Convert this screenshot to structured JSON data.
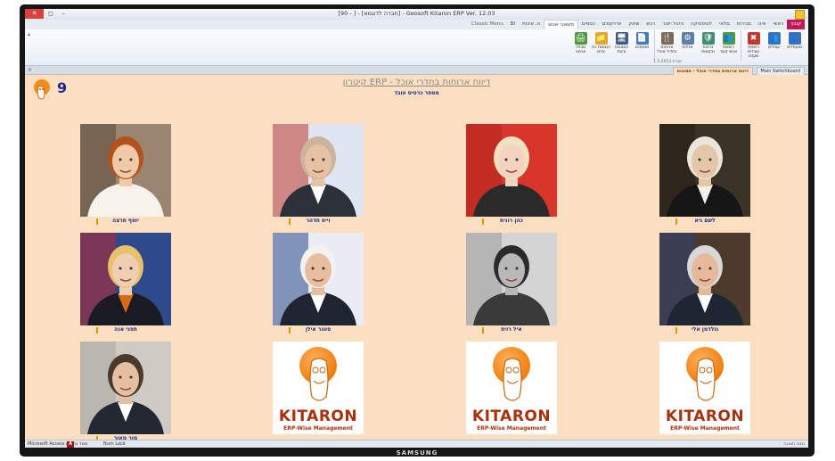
{
  "device": {
    "brand": "SAMSUNG"
  },
  "window": {
    "title": "[90 - ] - [חברה לדוגמא] - Geosoft Kitaron ERP Ver. 12.03",
    "controls": {
      "close": "✕",
      "restore": "◻",
      "minimize": "–"
    }
  },
  "ribbon_tabs": [
    {
      "label": "קובץ",
      "kind": "file"
    },
    {
      "label": "ראשי",
      "kind": "normal"
    },
    {
      "label": "אינו",
      "kind": "normal"
    },
    {
      "label": "מכירות",
      "kind": "normal"
    },
    {
      "label": "מלאי",
      "kind": "normal"
    },
    {
      "label": "לוגיסטיקה",
      "kind": "normal"
    },
    {
      "label": "ניהול ייצור",
      "kind": "normal"
    },
    {
      "label": "רכש",
      "kind": "normal"
    },
    {
      "label": "שיווק",
      "kind": "normal"
    },
    {
      "label": "פרויקטים",
      "kind": "normal"
    },
    {
      "label": "כספים",
      "kind": "normal"
    },
    {
      "label": "משאבי אנוש",
      "kind": "active"
    },
    {
      "label": "ה. איכות",
      "kind": "normal"
    },
    {
      "label": "BI",
      "kind": "normal"
    },
    {
      "label": "Classic Menu",
      "kind": "plain"
    }
  ],
  "ribbon_buttons": [
    {
      "icon": "👤",
      "color": "#3f6fb5",
      "label": "מועמדים"
    },
    {
      "icon": "👥",
      "color": "#3f6fb5",
      "label": "עובדים"
    },
    {
      "icon": "✖",
      "color": "#c0392b",
      "label": "רשימת עובדים שעזבו"
    },
    {
      "sep": true
    },
    {
      "icon": "👥",
      "color": "#4c9a3b",
      "label": "רשימת אנשי קשר"
    },
    {
      "icon": "🛡",
      "color": "#3f8f73",
      "label": "ברכות ובקשות"
    },
    {
      "icon": "⚙",
      "color": "#5d7fa8",
      "label": "אכלות"
    },
    {
      "icon": "🍴",
      "color": "#7c6a5a",
      "label": "ארוחות בחדרי אוכל"
    },
    {
      "sep": true
    },
    {
      "icon": "📄",
      "color": "#4a77b5",
      "label": "מסמכים"
    },
    {
      "icon": "🖥",
      "color": "#405a82",
      "label": "הסטבות ורגות"
    },
    {
      "icon": "📁",
      "color": "#e0a826",
      "label": "הוצאות כח אדם"
    },
    {
      "icon": "🖨",
      "color": "#4c9a3b",
      "label": "טבלה ארגוני"
    }
  ],
  "ribbon_group_caption": "אגרת 1.5.2013",
  "doc_tabs": {
    "main": "Main Switchboard",
    "current": "דיווח ארוחות בחדרי אוכל - תמונות"
  },
  "form": {
    "count": "9",
    "title": "קיטרון ERP - דיווח ארוחות בחדרי אוכל",
    "subtitle": "מספר כרטיס עובד"
  },
  "employees": [
    {
      "name": "לשם גיא",
      "photo": "washington"
    },
    {
      "name": "כהן רונית",
      "photo": "monroe"
    },
    {
      "name": "וייס תדהר",
      "photo": "putin"
    },
    {
      "name": "יוסף תרצה",
      "photo": "redhead"
    },
    {
      "name": "גולדמן אלי",
      "photo": "clinton"
    },
    {
      "name": "איל רוית",
      "photo": "bw_woman"
    },
    {
      "name": "סטגר אילן",
      "photo": "biden"
    },
    {
      "name": "תפני אנה",
      "photo": "hillary"
    },
    {
      "name": "",
      "photo": "kitaron"
    },
    {
      "name": "",
      "photo": "kitaron"
    },
    {
      "name": "",
      "photo": "kitaron"
    },
    {
      "name": "מור מאור",
      "photo": "medvedev"
    }
  ],
  "kitaron_logo": {
    "word": "KITARON",
    "tagline": "ERP-Wise Management"
  },
  "status_bar": {
    "left": "Microsoft Access מסד נתונים",
    "num_lock": "Num Lock",
    "right": "מצב תצוגה"
  }
}
